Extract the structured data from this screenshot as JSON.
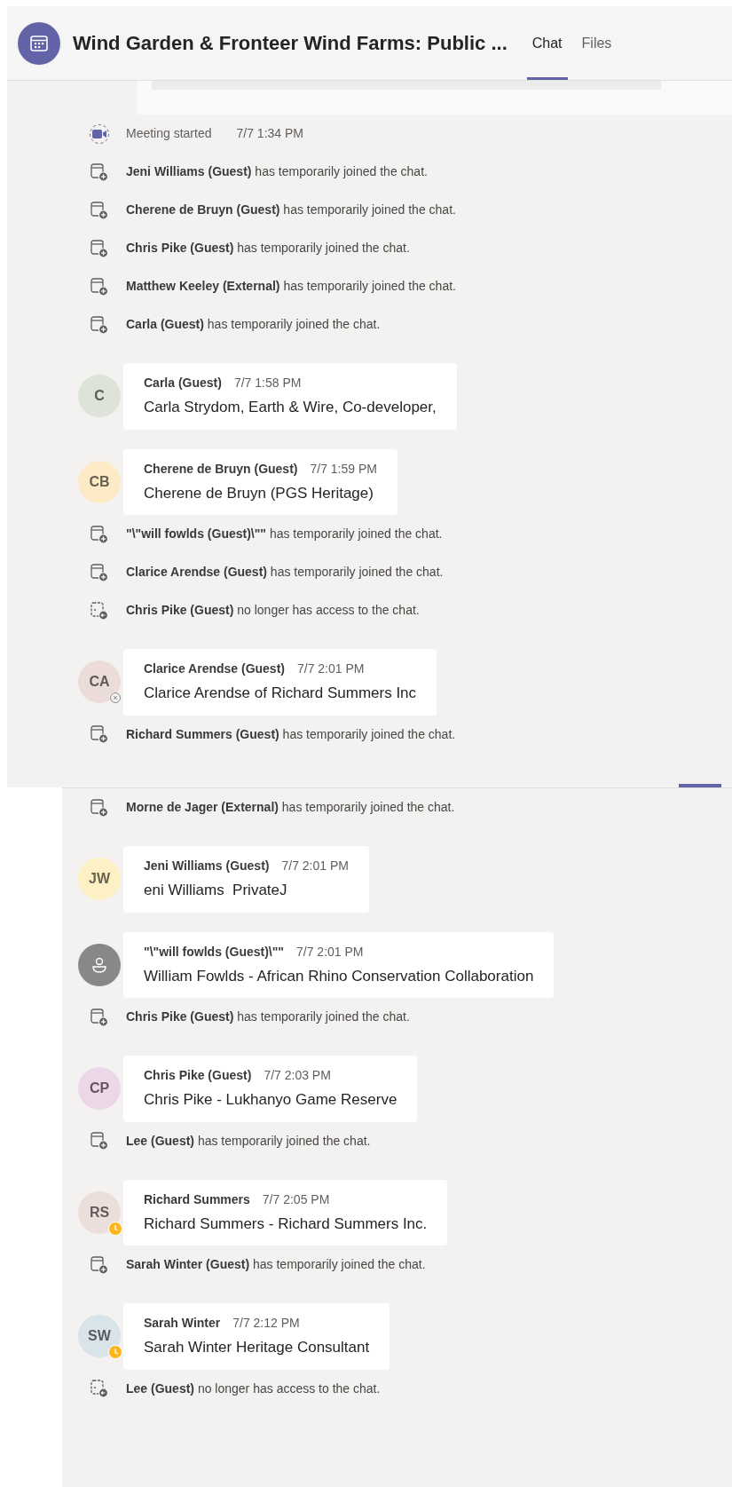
{
  "header": {
    "title": "Wind Garden & Fronteer Wind Farms: Public ...",
    "tabs": [
      {
        "label": "Chat",
        "selected": true
      },
      {
        "label": "Files",
        "selected": false
      }
    ]
  },
  "panels": [
    {
      "items": [
        {
          "kind": "meeting",
          "text": "Meeting started",
          "time": "7/7 1:34 PM"
        },
        {
          "kind": "joined",
          "text": "**Jeni Williams (Guest)** has temporarily joined the chat."
        },
        {
          "kind": "joined",
          "text": "**Cherene de Bruyn (Guest)** has temporarily joined the chat."
        },
        {
          "kind": "joined",
          "text": "**Chris Pike (Guest)** has temporarily joined the chat."
        },
        {
          "kind": "joined",
          "text": "**Matthew Keeley (External)** has temporarily joined the chat."
        },
        {
          "kind": "joined",
          "text": "**Carla (Guest)** has temporarily joined the chat."
        },
        {
          "kind": "message",
          "author": "Carla (Guest)",
          "time": "7/7 1:58 PM",
          "body": "Carla Strydom, Earth & Wire, Co-developer,",
          "avatar": {
            "kind": "initials",
            "initials": "C",
            "color": "#dde3d8"
          },
          "offline": false,
          "away": false
        },
        {
          "kind": "message",
          "author": "Cherene de Bruyn (Guest)",
          "time": "7/7 1:59 PM",
          "body": "Cherene de Bruyn (PGS Heritage)",
          "avatar": {
            "kind": "initials",
            "initials": "CB",
            "color": "#fcebc6"
          },
          "offline": false,
          "away": false
        },
        {
          "kind": "joined",
          "text": "**\"\\\"will fowlds (Guest)\\\"\"** has temporarily joined the chat."
        },
        {
          "kind": "joined",
          "text": "**Clarice Arendse (Guest)** has temporarily joined the chat."
        },
        {
          "kind": "left",
          "text": "**Chris Pike (Guest)** no longer has access to the chat."
        },
        {
          "kind": "message",
          "author": "Clarice Arendse (Guest)",
          "time": "7/7 2:01 PM",
          "body": "Clarice Arendse of Richard Summers Inc",
          "avatar": {
            "kind": "initials",
            "initials": "CA",
            "color": "#ecdcd9"
          },
          "offline": true,
          "away": false
        },
        {
          "kind": "joined",
          "text": "**Richard Summers (Guest)** has temporarily joined the chat."
        }
      ]
    },
    {
      "items": [
        {
          "kind": "joined",
          "text": "**Morne de Jager (External)** has temporarily joined the chat."
        },
        {
          "kind": "message",
          "author": "Jeni Williams (Guest)",
          "time": "7/7 2:01 PM",
          "body": "eni Williams  PrivateJ",
          "avatar": {
            "kind": "initials",
            "initials": "JW",
            "color": "#fdf0c4"
          },
          "offline": false,
          "away": false
        },
        {
          "kind": "message",
          "author": "\"\\\"will fowlds (Guest)\\\"\"",
          "time": "7/7 2:01 PM",
          "body": "William Fowlds - African Rhino Conservation Collaboration",
          "avatar": {
            "kind": "person",
            "color": "#8a8886"
          },
          "offline": false,
          "away": false
        },
        {
          "kind": "joined",
          "text": "**Chris Pike (Guest)** has temporarily joined the chat."
        },
        {
          "kind": "message",
          "author": "Chris Pike (Guest)",
          "time": "7/7 2:03 PM",
          "body": "Chris Pike - Lukhanyo Game Reserve",
          "avatar": {
            "kind": "initials",
            "initials": "CP",
            "color": "#ecd7e9"
          },
          "offline": false,
          "away": false
        },
        {
          "kind": "joined",
          "text": "**Lee (Guest)** has temporarily joined the chat."
        },
        {
          "kind": "message",
          "author": "Richard Summers",
          "time": "7/7 2:05 PM",
          "body": "Richard Summers - Richard Summers Inc.",
          "avatar": {
            "kind": "initials",
            "initials": "RS",
            "color": "#ecdfdb"
          },
          "offline": false,
          "away": true
        },
        {
          "kind": "joined",
          "text": "**Sarah Winter (Guest)** has temporarily joined the chat."
        },
        {
          "kind": "message",
          "author": "Sarah Winter",
          "time": "7/7 2:12 PM",
          "body": "Sarah Winter Heritage Consultant",
          "avatar": {
            "kind": "initials",
            "initials": "SW",
            "color": "#d8e3ea"
          },
          "offline": false,
          "away": true
        },
        {
          "kind": "left",
          "text": "**Lee (Guest)** no longer has access to the chat."
        }
      ]
    }
  ]
}
